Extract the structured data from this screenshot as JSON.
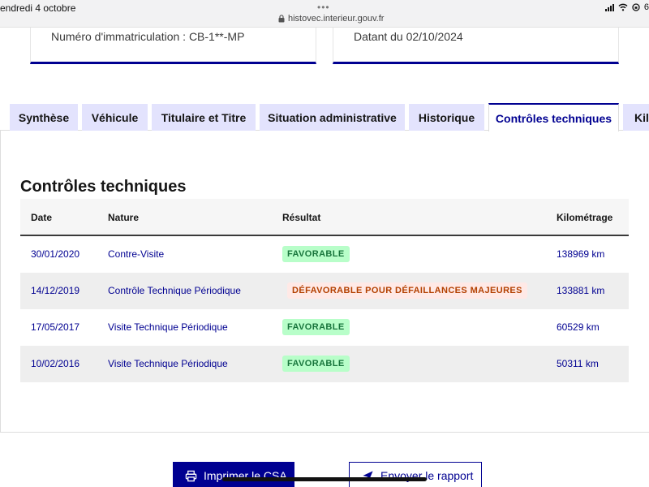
{
  "status_bar": {
    "date": "endredi 4 octobre",
    "url": "histovec.interieur.gouv.fr",
    "dots": "•••",
    "battery_partial": "6"
  },
  "cards": {
    "left_text": "Numéro d'immatriculation : CB-1**-MP",
    "right_text": "Datant du 02/10/2024"
  },
  "tabs": [
    {
      "label": "Synthèse"
    },
    {
      "label": "Véhicule"
    },
    {
      "label": "Titulaire et Titre"
    },
    {
      "label": "Situation administrative"
    },
    {
      "label": "Historique"
    },
    {
      "label": "Contrôles techniques",
      "active": true
    },
    {
      "label": "Kilo"
    }
  ],
  "section": {
    "title": "Contrôles techniques"
  },
  "table": {
    "headers": [
      "Date",
      "Nature",
      "Résultat",
      "Kilométrage"
    ],
    "rows": [
      {
        "date": "30/01/2020",
        "nature": "Contre-Visite",
        "result": "Favorable",
        "result_type": "favorable",
        "km": "138969 km"
      },
      {
        "date": "14/12/2019",
        "nature": "Contrôle Technique Périodique",
        "result": "Défavorable pour défaillances majeures",
        "result_type": "defavorable",
        "km": "133881 km"
      },
      {
        "date": "17/05/2017",
        "nature": "Visite Technique Périodique",
        "result": "Favorable",
        "result_type": "favorable",
        "km": "60529 km"
      },
      {
        "date": "10/02/2016",
        "nature": "Visite Technique Périodique",
        "result": "Favorable",
        "result_type": "favorable",
        "km": "50311 km"
      }
    ]
  },
  "actions": {
    "print_label": "Imprimer le CSA",
    "send_label": "Envoyer le rapport"
  },
  "colors": {
    "primary": "#000091",
    "tab_bg": "#e3e3fd",
    "success_bg": "#b8fec9",
    "success_text": "#18753c",
    "error_bg": "#ffe9e6",
    "error_text": "#b34000"
  },
  "icons": {
    "print": "printer-icon",
    "send": "paper-plane-icon",
    "lock": "lock-icon",
    "wifi": "wifi-icon",
    "signal": "signal-icon"
  }
}
